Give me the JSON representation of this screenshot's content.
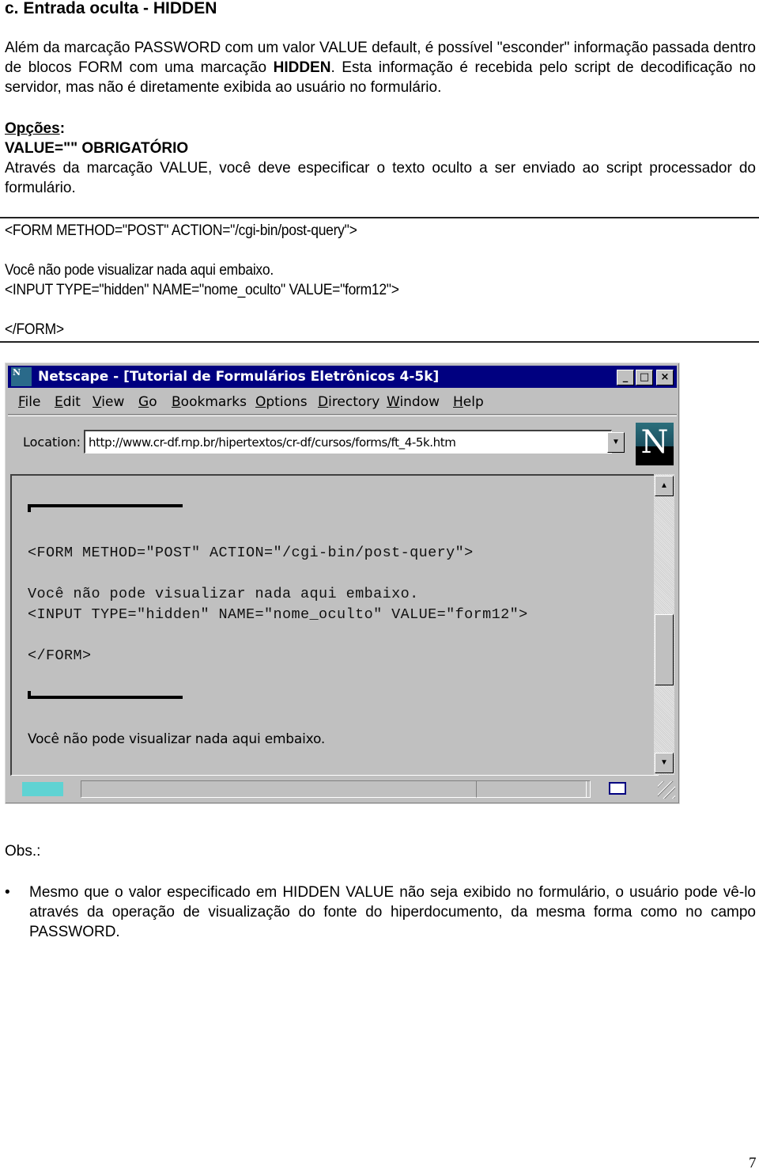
{
  "document": {
    "section_title": "c. Entrada oculta - HIDDEN",
    "intro": {
      "before_bold": "Além da marcação PASSWORD com um valor VALUE default, é possível \"esconder\" informação passada dentro de blocos FORM com uma marcação ",
      "bold": "HIDDEN",
      "after_bold": ". Esta informação é recebida pelo script de decodificação no servidor, mas não é diretamente exibida ao usuário no formulário."
    },
    "options": {
      "label": "Opções",
      "colon": ":",
      "value_attr": "VALUE=\"\" OBRIGATÓRIO",
      "description": "Através da marcação VALUE, você deve especificar o texto oculto a ser enviado ao script processador do formulário."
    },
    "code_example": {
      "lines": [
        "<FORM METHOD=\"POST\" ACTION=\"/cgi-bin/post-query\">",
        "Você não pode visualizar nada aqui embaixo.",
        "<INPUT TYPE=\"hidden\" NAME=\"nome_oculto\" VALUE=\"form12\">",
        "</FORM>"
      ]
    },
    "obs_label": "Obs.:",
    "bullet_symbol": "•",
    "bullets": [
      "Mesmo que o valor especificado em HIDDEN VALUE não seja exibido no formulário, o usuário pode vê-lo através da operação de visualização do fonte do hiperdocumento, da mesma forma como no campo PASSWORD."
    ],
    "page_number": "7"
  },
  "browser": {
    "app_icon_letter": "N",
    "title": "Netscape - [Tutorial de Formulários Eletrônicos 4-5k]",
    "window_buttons": {
      "minimize": "_",
      "maximize": "□",
      "close": "×"
    },
    "menu": [
      {
        "accel": "F",
        "rest": "ile"
      },
      {
        "accel": "E",
        "rest": "dit"
      },
      {
        "accel": "V",
        "rest": "iew"
      },
      {
        "accel": "G",
        "rest": "o"
      },
      {
        "accel": "B",
        "rest": "ookmarks"
      },
      {
        "accel": "O",
        "rest": "ptions"
      },
      {
        "accel": "D",
        "rest": "irectory"
      },
      {
        "accel": "W",
        "rest": "indow"
      },
      {
        "accel": "H",
        "rest": "elp"
      }
    ],
    "location_label": "Location:",
    "location_url": "http://www.cr-df.rnp.br/hipertextos/cr-df/cursos/forms/ft_4-5k.htm",
    "dropdown_arrow": "▼",
    "logo_letter": "N",
    "scroll_up": "▲",
    "scroll_down": "▼",
    "page_content": {
      "code_lines": [
        "<FORM METHOD=\"POST\" ACTION=\"/cgi-bin/post-query\">",
        "Você não pode visualizar nada aqui embaixo.",
        "<INPUT TYPE=\"hidden\" NAME=\"nome_oculto\" VALUE=\"form12\">",
        "</FORM>"
      ],
      "rendered_text": "Você não pode visualizar nada aqui embaixo."
    },
    "colors": {
      "titlebar": "#000080",
      "chrome": "#c0c0c0"
    }
  }
}
